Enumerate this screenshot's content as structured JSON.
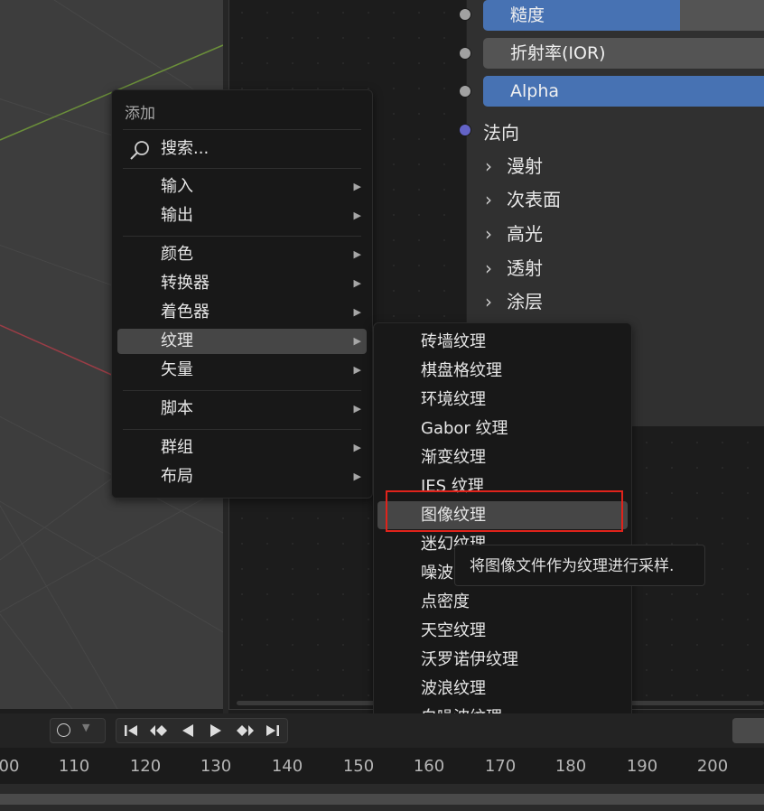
{
  "node_panel": {
    "roughness_label": "糙度",
    "roughness_fill": 0.68,
    "ior_label": "折射率(IOR)",
    "alpha_label": "Alpha",
    "alpha_fill": 1.0,
    "normal_label": "法向",
    "panels": [
      "漫射",
      "次表面",
      "高光",
      "透射",
      "涂层"
    ]
  },
  "add_menu": {
    "title": "添加",
    "search_label": "搜索...",
    "items": [
      "输入",
      "输出",
      "颜色",
      "转换器",
      "着色器",
      "纹理",
      "矢量",
      "脚本",
      "群组",
      "布局"
    ],
    "active_item": "纹理"
  },
  "texture_menu": {
    "items": [
      "砖墙纹理",
      "棋盘格纹理",
      "环境纹理",
      "Gabor 纹理",
      "渐变纹理",
      "IES 纹理",
      "图像纹理",
      "迷幻纹理",
      "噪波",
      "点密度",
      "天空纹理",
      "沃罗诺伊纹理",
      "波浪纹理",
      "白噪波纹理"
    ],
    "active_item": "图像纹理"
  },
  "tooltip": {
    "text": "将图像文件作为纹理进行采样."
  },
  "timeline": {
    "frames": [
      "00",
      "110",
      "120",
      "130",
      "140",
      "150",
      "160",
      "170",
      "180",
      "190",
      "200"
    ],
    "playback_icons": [
      "jump-start-icon",
      "prev-keyframe-icon",
      "play-reverse-icon",
      "play-icon",
      "next-keyframe-icon",
      "jump-end-icon"
    ]
  },
  "colors": {
    "accent_blue": "#4772b3",
    "socket_gray": "#a1a1a1",
    "socket_vector": "#6363c7",
    "highlight_red": "#e0231b"
  }
}
